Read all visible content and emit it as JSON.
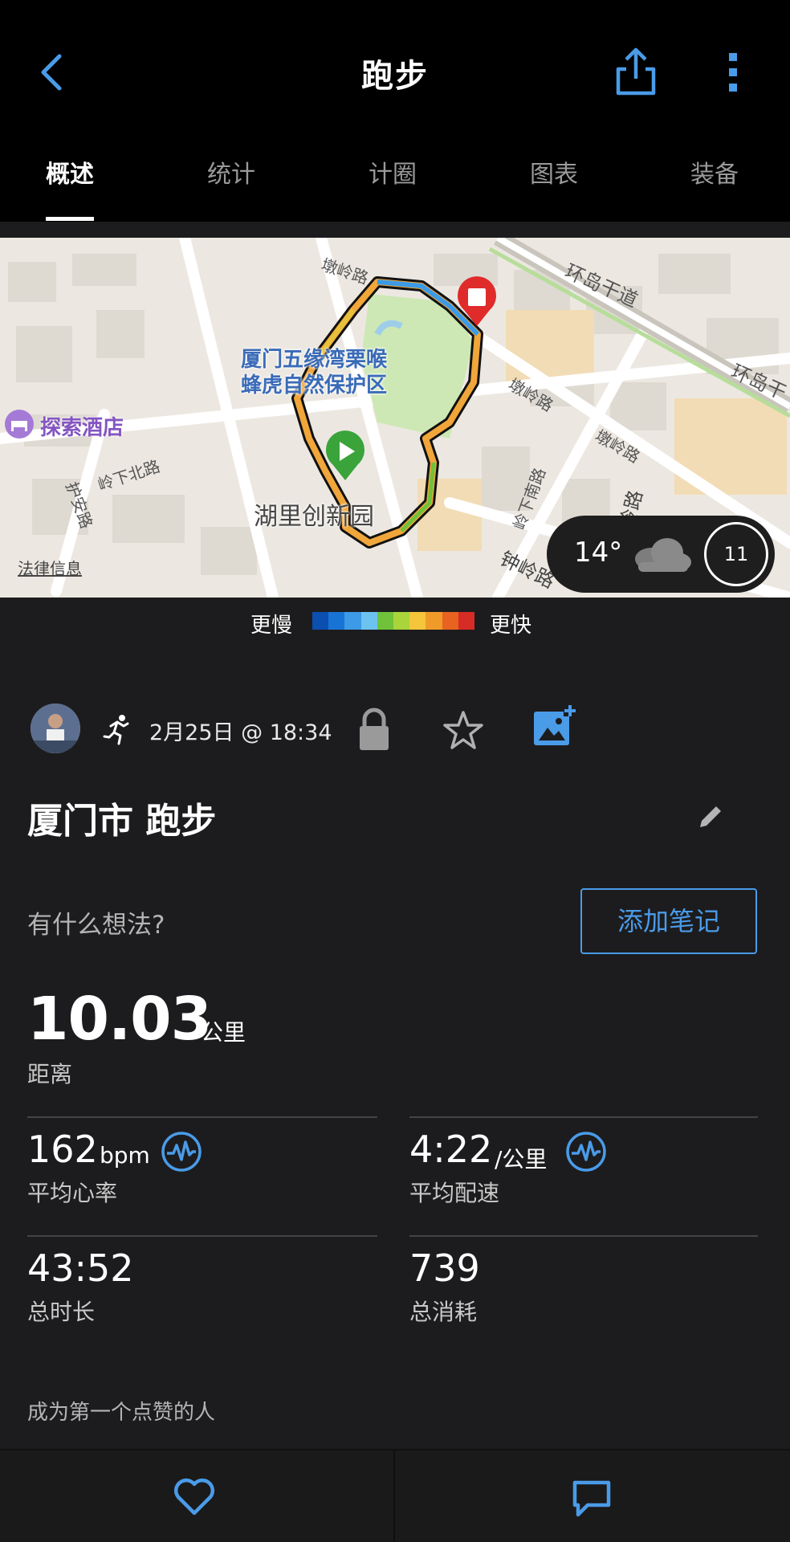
{
  "header": {
    "title": "跑步"
  },
  "tabs": [
    {
      "label": "概述"
    },
    {
      "label": "统计"
    },
    {
      "label": "计圈"
    },
    {
      "label": "图表"
    },
    {
      "label": "装备"
    }
  ],
  "map": {
    "roads": [
      "墩岭路",
      "环岛干道",
      "环岛干",
      "墩岭路",
      "墩岭路",
      "岭下北路",
      "护安路",
      "岭下南路",
      "钟岭路",
      "岭路"
    ],
    "park": [
      "厦门五缘湾栗喉",
      "蜂虎自然保护区"
    ],
    "hotel": "探索酒店",
    "poi": "湖里创新园",
    "legal": "法律信息",
    "weather": {
      "temperature": "14°",
      "wind_speed": "11"
    }
  },
  "legend": {
    "slow": "更慢",
    "fast": "更快",
    "colors": [
      "#0b4fb0",
      "#1874d4",
      "#3c9ae6",
      "#6cc3f0",
      "#6fc23a",
      "#a9d43a",
      "#f5c53a",
      "#f09a2a",
      "#e8631f",
      "#d72b25"
    ]
  },
  "activity": {
    "date": "2月25日 @ 18:34",
    "title": "厦门市 跑步",
    "thoughts_prompt": "有什么想法?",
    "add_note": "添加笔记"
  },
  "stats": {
    "distance": {
      "value": "10.03",
      "unit": "公里",
      "label": "距离"
    },
    "heart_rate": {
      "value": "162",
      "unit": "bpm",
      "label": "平均心率"
    },
    "pace": {
      "value": "4:22",
      "unit": "/公里",
      "label": "平均配速"
    },
    "duration": {
      "value": "43:52",
      "label": "总时长"
    },
    "calories": {
      "value": "739",
      "label": "总消耗"
    }
  },
  "social": {
    "likes_prompt": "成为第一个点赞的人"
  },
  "colors": {
    "accent": "#4a9be8",
    "background": "#1c1c1e",
    "header": "#000000"
  }
}
